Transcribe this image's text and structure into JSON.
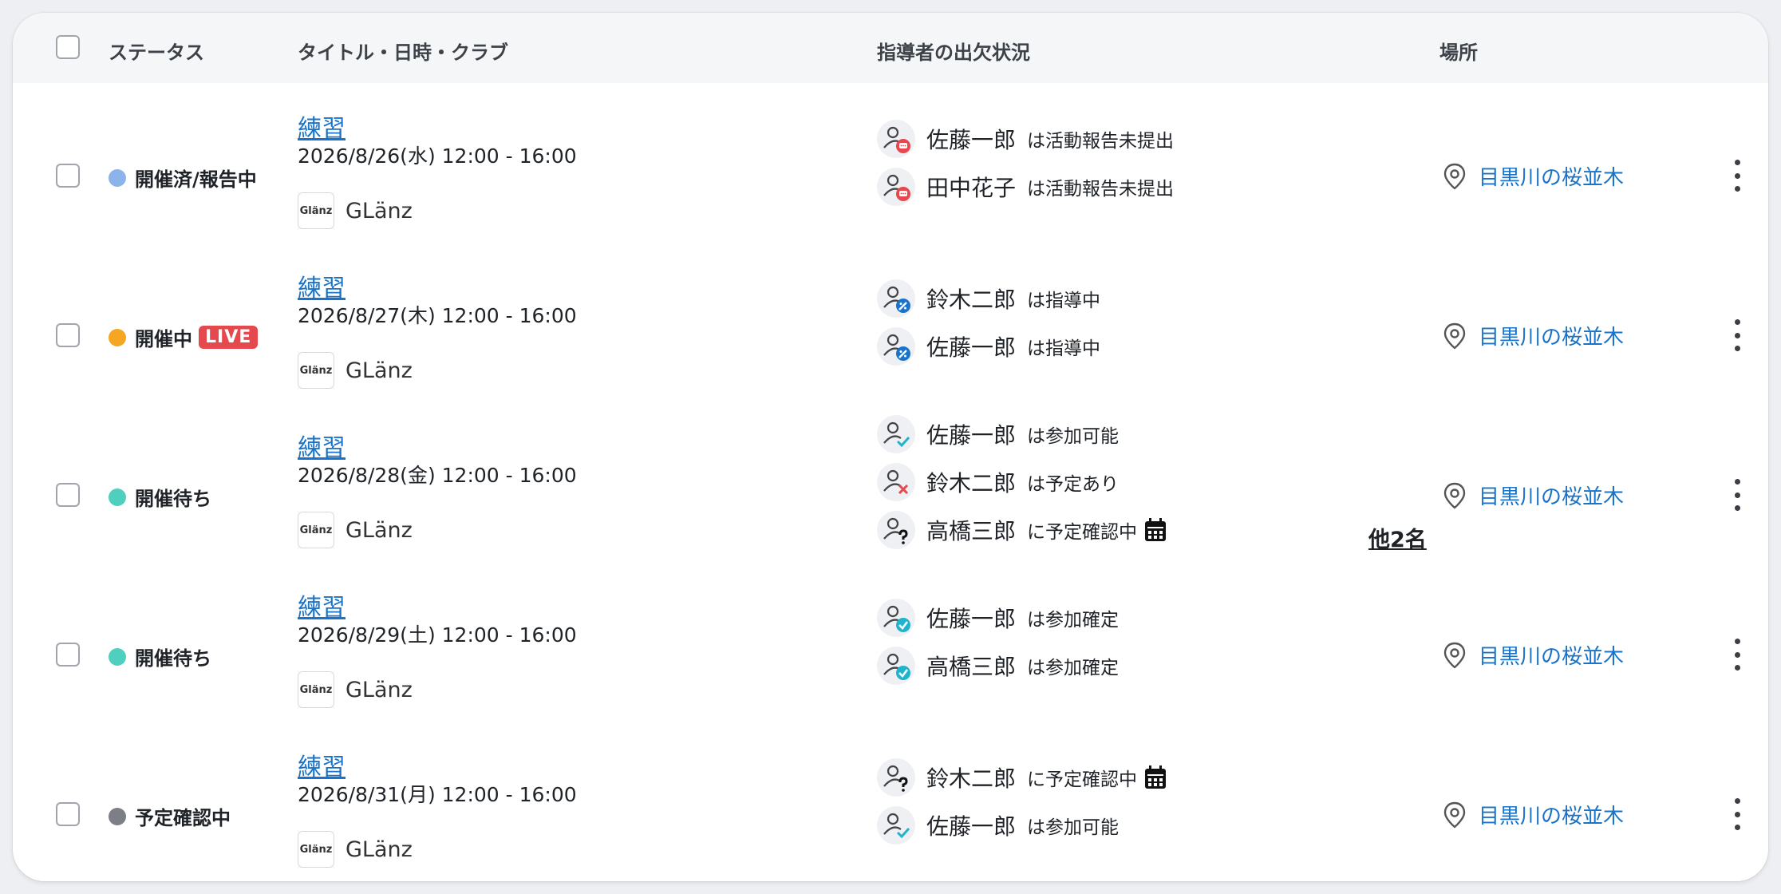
{
  "header": {
    "status": "ステータス",
    "title_date_club": "タイトル・日時・クラブ",
    "coach_attendance": "指導者の出欠状況",
    "place": "場所"
  },
  "colors": {
    "reported": "#8db4ea",
    "live": "#f5a623",
    "waiting": "#4fcfbe",
    "confirming": "#7c7f85",
    "link": "#1a73c8",
    "live_badge": "#e5484d"
  },
  "rows": [
    {
      "status": "開催済/報告中",
      "title": "練習",
      "datetime": "2026/8/26(水) 12:00 - 16:00",
      "club_logo": "Glänz",
      "club": "GLänz",
      "coaches": [
        {
          "name": "佐藤一郎",
          "status": "は活動報告未提出",
          "icon": "report-pending-icon"
        },
        {
          "name": "田中花子",
          "status": "は活動報告未提出",
          "icon": "report-pending-icon"
        }
      ],
      "place": "目黒川の桜並木"
    },
    {
      "status": "開催中",
      "live": "LIVE",
      "title": "練習",
      "datetime": "2026/8/27(木) 12:00 - 16:00",
      "club_logo": "Glänz",
      "club": "GLänz",
      "coaches": [
        {
          "name": "鈴木二郎",
          "status": "は指導中",
          "icon": "coaching-icon"
        },
        {
          "name": "佐藤一郎",
          "status": "は指導中",
          "icon": "coaching-icon"
        }
      ],
      "place": "目黒川の桜並木"
    },
    {
      "status": "開催待ち",
      "title": "練習",
      "datetime": "2026/8/28(金) 12:00 - 16:00",
      "club_logo": "Glänz",
      "club": "GLänz",
      "coaches": [
        {
          "name": "佐藤一郎",
          "status": "は参加可能",
          "icon": "available-icon"
        },
        {
          "name": "鈴木二郎",
          "status": "は予定あり",
          "icon": "busy-icon"
        },
        {
          "name": "高橋三郎",
          "status": "に予定確認中",
          "icon": "confirming-icon"
        }
      ],
      "more": "他2名",
      "place": "目黒川の桜並木"
    },
    {
      "status": "開催待ち",
      "title": "練習",
      "datetime": "2026/8/29(土) 12:00 - 16:00",
      "club_logo": "Glänz",
      "club": "GLänz",
      "coaches": [
        {
          "name": "佐藤一郎",
          "status": "は参加確定",
          "icon": "confirmed-icon"
        },
        {
          "name": "高橋三郎",
          "status": "は参加確定",
          "icon": "confirmed-icon"
        }
      ],
      "place": "目黒川の桜並木"
    },
    {
      "status": "予定確認中",
      "title": "練習",
      "datetime": "2026/8/31(月) 12:00 - 16:00",
      "club_logo": "Glänz",
      "club": "GLänz",
      "coaches": [
        {
          "name": "鈴木二郎",
          "status": "に予定確認中",
          "icon": "confirming-icon"
        },
        {
          "name": "佐藤一郎",
          "status": "は参加可能",
          "icon": "available-icon"
        }
      ],
      "place": "目黒川の桜並木"
    }
  ]
}
